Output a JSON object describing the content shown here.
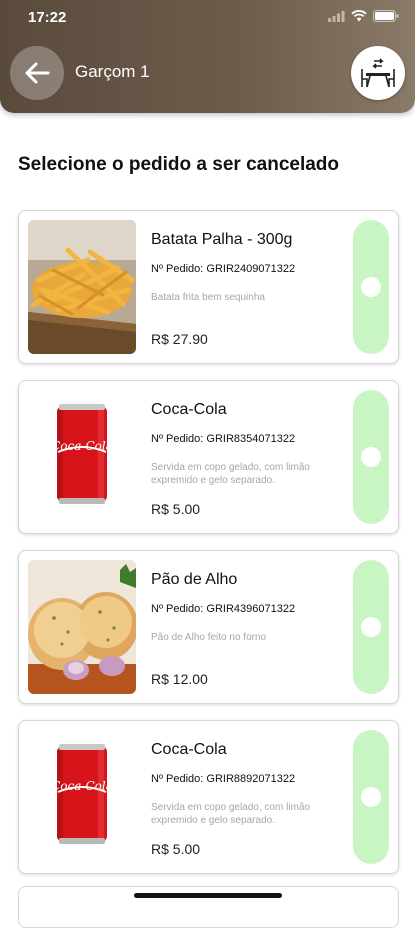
{
  "status_bar": {
    "time": "17:22"
  },
  "header": {
    "title": "Garçom 1"
  },
  "page_title": "Selecione o pedido a ser cancelado",
  "items": [
    {
      "name": "Batata Palha - 300g",
      "order_number": "Nº Pedido: GRIR2409071322",
      "description": "Batata frita bem sequinha",
      "price": "R$ 27.90",
      "image": "fries"
    },
    {
      "name": "Coca-Cola",
      "order_number": "Nº Pedido: GRIR8354071322",
      "description": "Servida em copo gelado, com limão expremido e gelo separado.",
      "price": "R$ 5.00",
      "image": "coke"
    },
    {
      "name": "Pão de Alho",
      "order_number": "Nº Pedido: GRIR4396071322",
      "description": "Pão de Alho feito no forno",
      "price": "R$ 12.00",
      "image": "garlic-bread"
    },
    {
      "name": "Coca-Cola",
      "order_number": "Nº Pedido: GRIR8892071322",
      "description": "Servida em copo gelado, com limão expremido e gelo separado.",
      "price": "R$ 5.00",
      "image": "coke"
    }
  ],
  "colors": {
    "header": "#6e5d4c",
    "select_button": "#c9f5c4"
  },
  "icons": [
    "back-arrow-icon",
    "waiter-table-icon",
    "signal-icon",
    "wifi-icon",
    "battery-icon"
  ]
}
